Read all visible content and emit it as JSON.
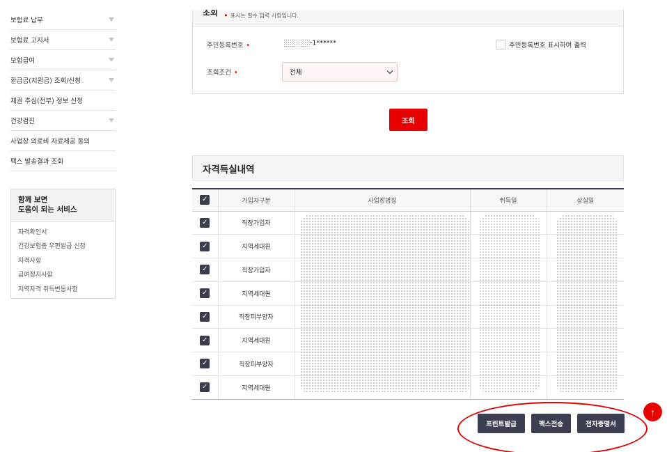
{
  "sidebar": {
    "items": [
      {
        "label": "보험료 납부",
        "has_arrow": true
      },
      {
        "label": "보험료 고지서",
        "has_arrow": true
      },
      {
        "label": "보험급여",
        "has_arrow": true
      },
      {
        "label": "환급금(지원금) 조회/신청",
        "has_arrow": true
      },
      {
        "label": "채권 추심(전부) 정보 신청",
        "has_arrow": false
      },
      {
        "label": "건강검진",
        "has_arrow": true
      },
      {
        "label": "사업장 의료비 자료제공 동의",
        "has_arrow": false
      },
      {
        "label": "팩스 발송결과 조회",
        "has_arrow": false
      }
    ],
    "related": {
      "title_line1": "함께 보면",
      "title_line2": "도움이 되는 서비스",
      "links": [
        "자격확인서",
        "건강보험증 우편발급 신청",
        "자격사항",
        "급여정지사항",
        "지역자격 취득변동사항"
      ]
    }
  },
  "search": {
    "title": "조회",
    "required_mark": "•",
    "note": "표시는 필수 입력 사항입니다.",
    "rrn_label": "주민등록번호",
    "rrn_value_suffix": "-1******",
    "show_rrn_label": "주민등록번호 표시하여 출력",
    "condition_label": "조회조건",
    "condition_value": "전체",
    "search_button": "조회"
  },
  "section_title": "자격득실내역",
  "table": {
    "headers": [
      "가입자구분",
      "사업장명칭",
      "취득일",
      "상실일"
    ],
    "rows": [
      "직장가입자",
      "지역세대원",
      "직장가입자",
      "지역세대원",
      "직장피부양자",
      "지역세대원",
      "직장피부양자",
      "지역세대원"
    ]
  },
  "actions": {
    "print": "프린트발급",
    "fax": "팩스전송",
    "e_cert": "전자증명서"
  },
  "colors": {
    "accent": "#e60000",
    "dark_button": "#3c3f52",
    "checkbox": "#3a3d4e"
  }
}
